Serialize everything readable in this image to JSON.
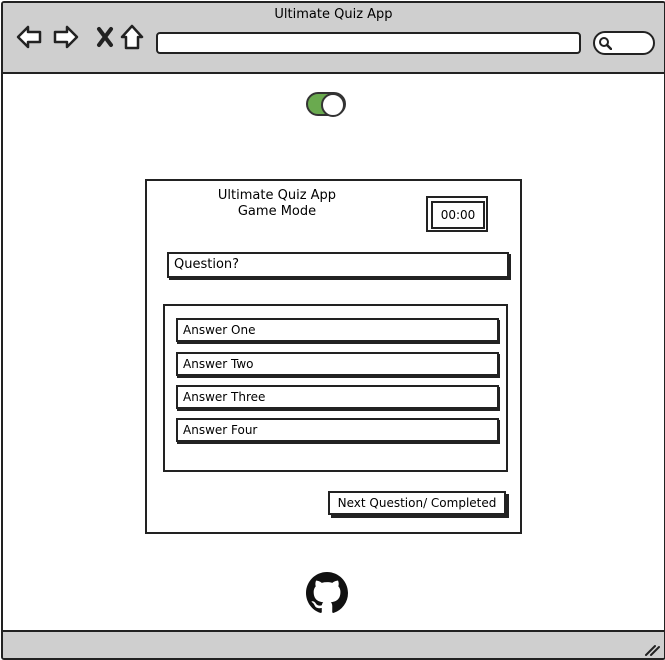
{
  "window": {
    "title": "Ultimate Quiz App"
  },
  "toolbar": {
    "back_icon": "arrow-left-icon",
    "forward_icon": "arrow-right-icon",
    "stop_icon": "close-icon",
    "home_icon": "home-icon",
    "address_value": "",
    "search_icon": "search-icon"
  },
  "toggle": {
    "state": "on",
    "color": "#6aaa4f"
  },
  "quiz": {
    "title_line1": "Ultimate Quiz App",
    "title_line2": "Game Mode",
    "timer": "00:00",
    "question": "Question?",
    "answers": [
      "Answer One",
      "Answer Two",
      "Answer Three",
      "Answer Four"
    ],
    "next_label": "Next Question/ Completed"
  },
  "footer": {
    "icon": "github-icon"
  }
}
